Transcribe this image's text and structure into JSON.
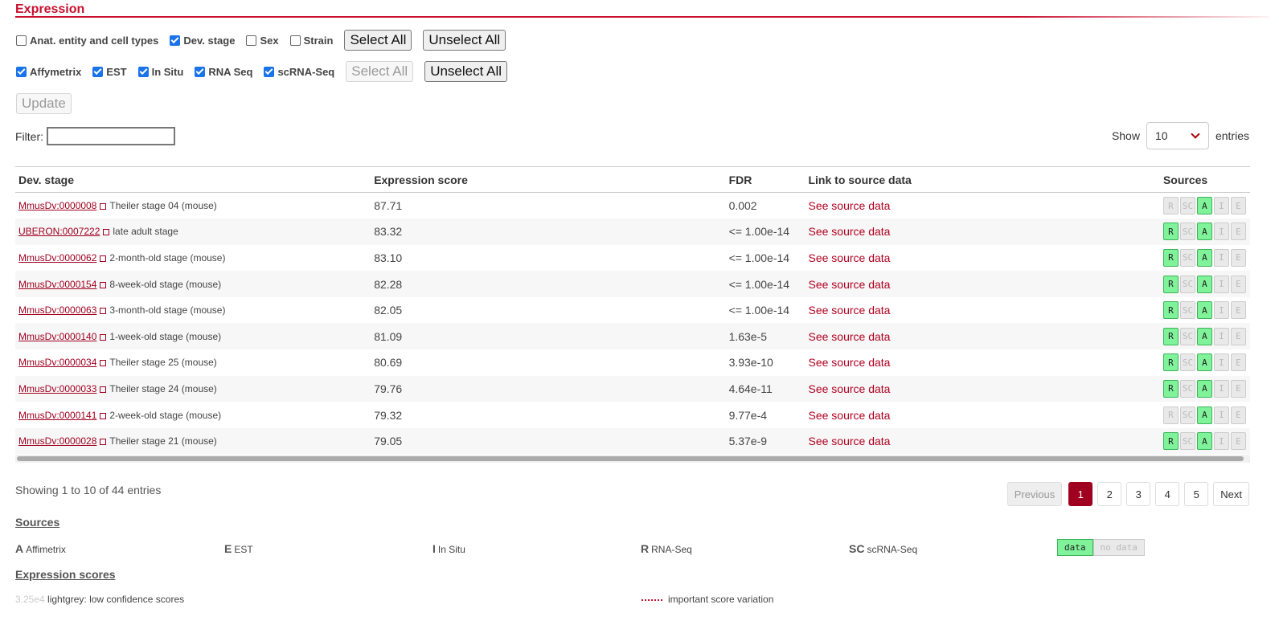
{
  "section": {
    "title": "Expression"
  },
  "conditions": {
    "options": [
      {
        "label": "Anat. entity and cell types",
        "checked": false
      },
      {
        "label": "Dev. stage",
        "checked": true
      },
      {
        "label": "Sex",
        "checked": false
      },
      {
        "label": "Strain",
        "checked": false
      }
    ],
    "select_all": "Select All",
    "unselect_all": "Unselect All"
  },
  "data_types": {
    "options": [
      {
        "label": "Affymetrix",
        "checked": true
      },
      {
        "label": "EST",
        "checked": true
      },
      {
        "label": "In Situ",
        "checked": true
      },
      {
        "label": "RNA Seq",
        "checked": true
      },
      {
        "label": "scRNA-Seq",
        "checked": true
      }
    ],
    "select_all": "Select All",
    "unselect_all": "Unselect All"
  },
  "update_label": "Update",
  "filter": {
    "label": "Filter:",
    "value": ""
  },
  "length": {
    "show": "Show",
    "value": "10",
    "entries": "entries"
  },
  "table": {
    "headers": [
      "Dev. stage",
      "Expression score",
      "FDR",
      "Link to source data",
      "Sources"
    ],
    "link_text": "See source data",
    "rows": [
      {
        "id": "MmusDv:0000008",
        "name": "Theiler stage 04 (mouse)",
        "score": "87.71",
        "fdr": "0.002",
        "sources": [
          false,
          false,
          true,
          false,
          false
        ]
      },
      {
        "id": "UBERON:0007222",
        "name": "late adult stage",
        "score": "83.32",
        "fdr": "<= 1.00e-14",
        "sources": [
          true,
          false,
          true,
          false,
          false
        ]
      },
      {
        "id": "MmusDv:0000062",
        "name": "2-month-old stage (mouse)",
        "score": "83.10",
        "fdr": "<= 1.00e-14",
        "sources": [
          true,
          false,
          true,
          false,
          false
        ]
      },
      {
        "id": "MmusDv:0000154",
        "name": "8-week-old stage (mouse)",
        "score": "82.28",
        "fdr": "<= 1.00e-14",
        "sources": [
          true,
          false,
          true,
          false,
          false
        ]
      },
      {
        "id": "MmusDv:0000063",
        "name": "3-month-old stage (mouse)",
        "score": "82.05",
        "fdr": "<= 1.00e-14",
        "sources": [
          true,
          false,
          true,
          false,
          false
        ]
      },
      {
        "id": "MmusDv:0000140",
        "name": "1-week-old stage (mouse)",
        "score": "81.09",
        "fdr": "1.63e-5",
        "sources": [
          true,
          false,
          true,
          false,
          false
        ]
      },
      {
        "id": "MmusDv:0000034",
        "name": "Theiler stage 25 (mouse)",
        "score": "80.69",
        "fdr": "3.93e-10",
        "sources": [
          true,
          false,
          true,
          false,
          false
        ]
      },
      {
        "id": "MmusDv:0000033",
        "name": "Theiler stage 24 (mouse)",
        "score": "79.76",
        "fdr": "4.64e-11",
        "sources": [
          true,
          false,
          true,
          false,
          false
        ]
      },
      {
        "id": "MmusDv:0000141",
        "name": "2-week-old stage (mouse)",
        "score": "79.32",
        "fdr": "9.77e-4",
        "sources": [
          false,
          false,
          true,
          false,
          false
        ]
      },
      {
        "id": "MmusDv:0000028",
        "name": "Theiler stage 21 (mouse)",
        "score": "79.05",
        "fdr": "5.37e-9",
        "sources": [
          true,
          false,
          true,
          false,
          false
        ]
      }
    ],
    "source_codes": [
      "R",
      "SC",
      "A",
      "I",
      "E"
    ]
  },
  "info": "Showing 1 to 10 of 44 entries",
  "pager": {
    "previous": "Previous",
    "pages": [
      "1",
      "2",
      "3",
      "4",
      "5"
    ],
    "current": "1",
    "next": "Next"
  },
  "sources_legend": {
    "title": "Sources",
    "items": [
      {
        "code": "A",
        "label": "Affimetrix"
      },
      {
        "code": "E",
        "label": "EST"
      },
      {
        "code": "I",
        "label": "In Situ"
      },
      {
        "code": "R",
        "label": "RNA-Seq"
      },
      {
        "code": "SC",
        "label": "scRNA-Seq"
      }
    ],
    "data": "data",
    "no_data": "no data"
  },
  "scores_legend": {
    "title": "Expression scores",
    "grey_value": "3.25e4",
    "grey_text": "lightgrey: low confidence scores",
    "variation_text": "important score variation"
  },
  "colors": {
    "accent": "#c8102e",
    "link": "#a0001f",
    "badge_on": "#7ff29a",
    "badge_off": "#e9e9e9"
  }
}
